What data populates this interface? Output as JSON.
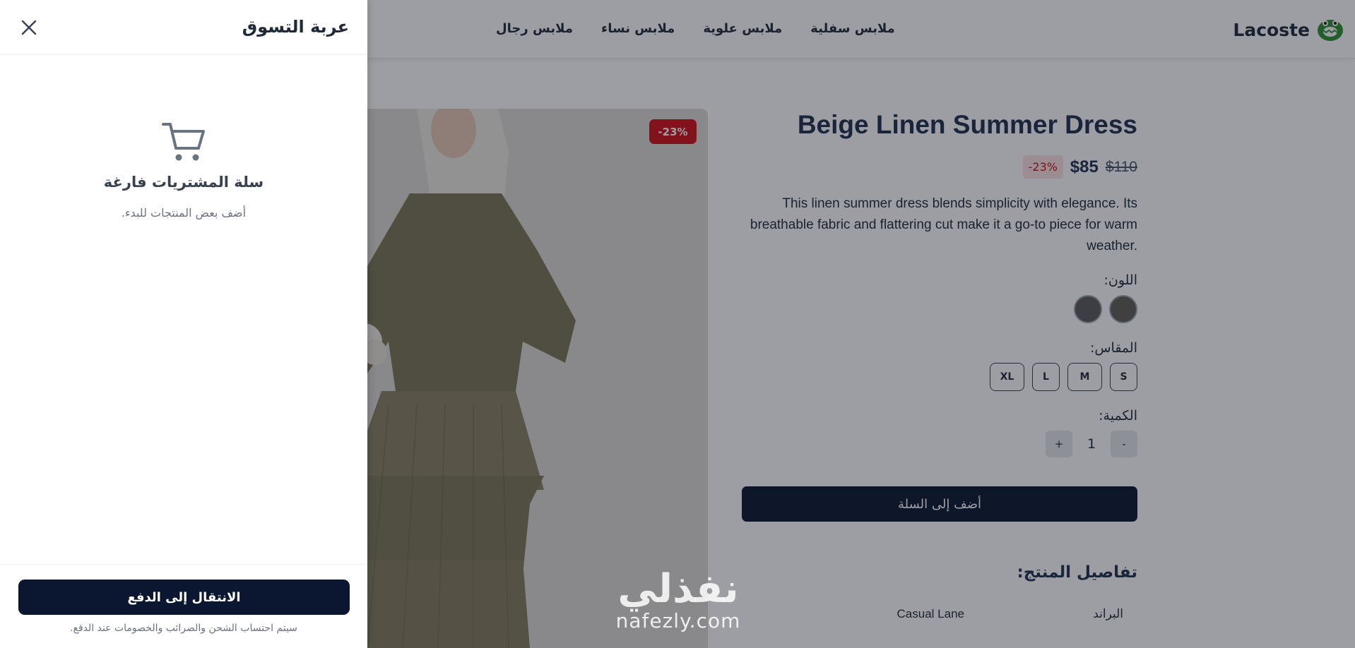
{
  "nav": {
    "brand": "Lacoste",
    "menu": [
      "ملابس رجال",
      "ملابس نساء",
      "ملابس علوية",
      "ملابس سفلية"
    ]
  },
  "product": {
    "image_badge": "-23%",
    "title": "Beige Linen Summer Dress",
    "price_new": "$85",
    "price_old": "$110",
    "price_badge": "-23%",
    "description": "This linen summer dress blends simplicity with elegance. Its breathable fabric and flattering cut make it a go-to piece for warm weather.",
    "color_label": "اللون:",
    "colors": [
      "#5f5e53",
      "#5b5b5b"
    ],
    "size_label": "المقاس:",
    "sizes": [
      "S",
      "M",
      "L",
      "XL"
    ],
    "qty_label": "الكمية:",
    "qty_minus": "-",
    "qty_value": "1",
    "qty_plus": "+",
    "add_to_cart": "أضف إلى السلة",
    "details_title": "تفاصيل المنتج:",
    "brand_label": "البراند",
    "brand_value": "Casual Lane"
  },
  "cart": {
    "title": "عربة التسوق",
    "empty_title": "سلة المشتريات فارغة",
    "empty_subtitle": "أضف بعض المنتجات للبدء.",
    "checkout": "الانتقال إلى الدفع",
    "footnote": "سيتم احتساب الشحن والضرائب والخصومات عند الدفع."
  },
  "watermark": {
    "arabic": "نفذلي",
    "latin": "nafezly.com"
  },
  "colors": {
    "navy": "#0b1730",
    "sale_red": "#d31118",
    "badge_bg": "#fde2e2"
  }
}
